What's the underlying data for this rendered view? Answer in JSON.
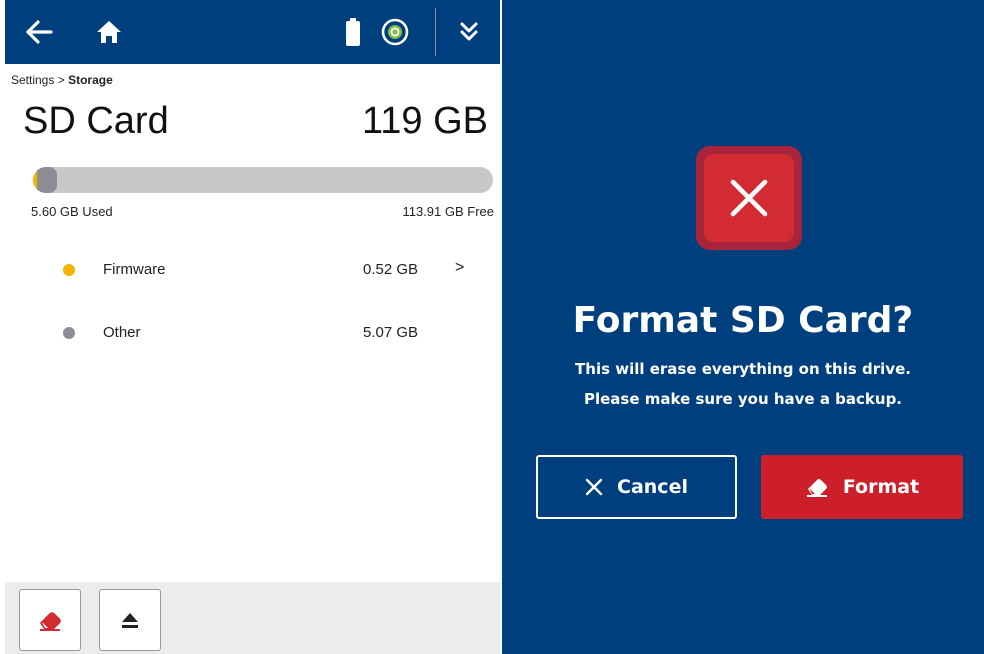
{
  "breadcrumb": {
    "parent": "Settings",
    "separator": ">",
    "current": "Storage"
  },
  "storage": {
    "title": "SD Card",
    "capacity": "119 GB",
    "used_label": "5.60 GB Used",
    "free_label": "113.91 GB Free",
    "usage_fraction": {
      "firmware": 0.004,
      "other": 0.043
    },
    "items": [
      {
        "name": "Firmware",
        "size": "0.52 GB",
        "color": "#f4b400",
        "chevron": ">"
      },
      {
        "name": "Other",
        "size": "5.07 GB",
        "color": "#8e8d96"
      }
    ]
  },
  "toolbar_icons": [
    "back-arrow-icon",
    "home-icon",
    "battery-icon",
    "sync-status-icon",
    "expand-chevrons-icon"
  ],
  "bottom_icons": [
    "eraser-icon",
    "eject-icon"
  ],
  "dialog": {
    "title": "Format SD Card?",
    "message_line1": "This will erase everything on this drive.",
    "message_line2": "Please make sure you have a backup.",
    "cancel_label": "Cancel",
    "format_label": "Format"
  },
  "colors": {
    "header_blue": "#003f7d",
    "danger_red": "#cc1f2a",
    "error_icon_red": "#d32b33",
    "firmware_yellow": "#f4b400",
    "other_gray": "#8e8d96"
  }
}
